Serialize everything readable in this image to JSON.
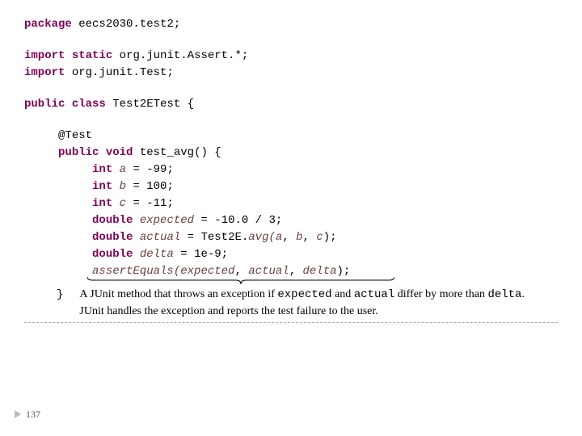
{
  "code": {
    "package_kw": "package",
    "package_name": " eecs2030.test2;",
    "import_kw": "import",
    "static_kw": "static",
    "import1_rest": " org.junit.Assert.*;",
    "import2_rest": " org.junit.Test;",
    "public_kw": "public",
    "class_kw": "class",
    "class_decl": " Test2ETest {",
    "annotation_test": "@Test",
    "void_kw": "void",
    "method_name": " test_avg() {",
    "int_kw": "int",
    "a_var": "a",
    "a_rest": " = -99;",
    "b_var": "b",
    "b_rest": " = 100;",
    "c_var": "c",
    "c_rest": " = -11;",
    "double_kw": "double",
    "expected_var": "expected",
    "expected_rest": " = -10.0 / 3;",
    "actual_var": "actual",
    "actual_eq": " = Test2E.",
    "avg_call": "avg(",
    "a2": "a",
    "comma1": ", ",
    "b2": "b",
    "comma2": ", ",
    "c2": "c",
    "call_end": ");",
    "delta_var": "delta",
    "delta_rest": " = 1e-9;",
    "assert_call": "assertEquals(",
    "exp2": "expected",
    "act2": "actual",
    "del2": "delta",
    "close_brace": "}"
  },
  "note": {
    "part1": "A JUnit method that throws an exception if ",
    "tt1": "expected",
    "part2": " and ",
    "tt2": "actual",
    "part3": " differ by more than ",
    "tt3": "delta",
    "part4": ".  JUnit handles the exception and reports the test failure to the user."
  },
  "page_number": "137"
}
